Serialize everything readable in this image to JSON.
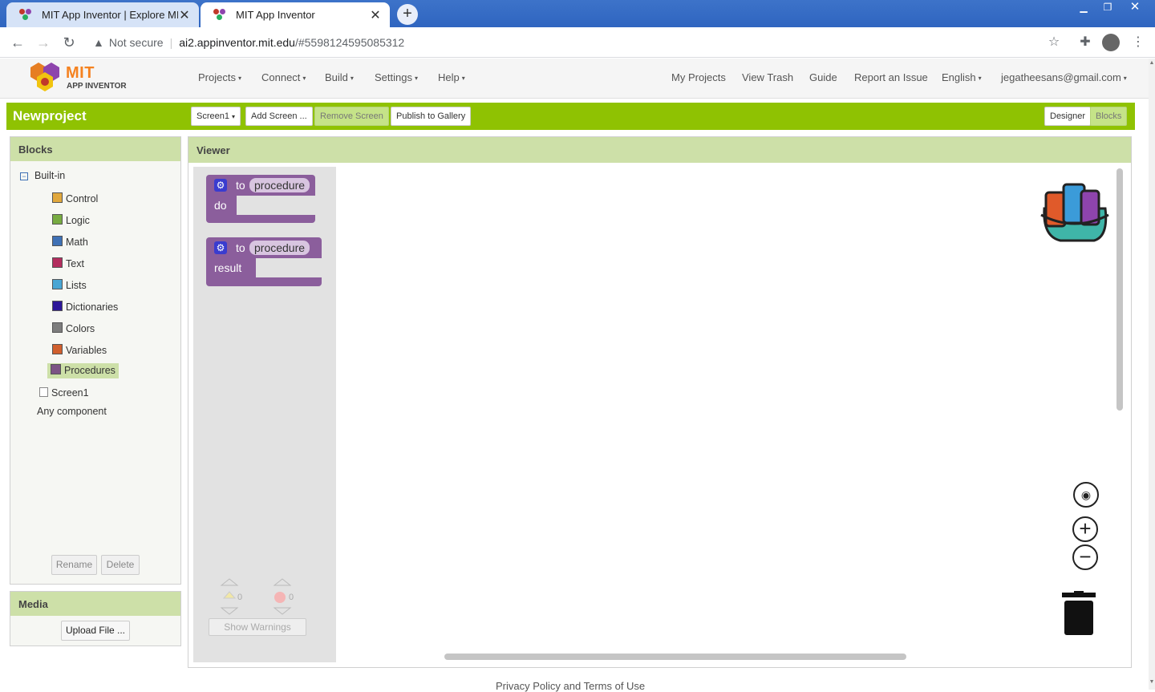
{
  "browser": {
    "tabs": [
      {
        "title": "MIT App Inventor | Explore MIT A"
      },
      {
        "title": "MIT App Inventor"
      }
    ],
    "url_security": "Not secure",
    "url_host": "ai2.appinventor.mit.edu",
    "url_hash": "/#5598124595085312"
  },
  "app": {
    "logo_title": "MIT",
    "logo_subtitle": "APP INVENTOR",
    "menus": [
      "Projects",
      "Connect",
      "Build",
      "Settings",
      "Help"
    ],
    "right_links": [
      "My Projects",
      "View Trash",
      "Guide",
      "Report an Issue",
      "English",
      "jegatheesans@gmail.com"
    ],
    "project_name": "Newproject",
    "toolbar": {
      "screen_select": "Screen1",
      "add_screen": "Add Screen ...",
      "remove_screen": "Remove Screen",
      "publish": "Publish to Gallery",
      "designer": "Designer",
      "blocks": "Blocks"
    }
  },
  "blocks_panel": {
    "title": "Blocks",
    "builtin": "Built-in",
    "categories": [
      {
        "label": "Control",
        "color": "#e1a83d"
      },
      {
        "label": "Logic",
        "color": "#77ab41"
      },
      {
        "label": "Math",
        "color": "#3f71b5"
      },
      {
        "label": "Text",
        "color": "#b32d5e"
      },
      {
        "label": "Lists",
        "color": "#49a6d4"
      },
      {
        "label": "Dictionaries",
        "color": "#2d1799"
      },
      {
        "label": "Colors",
        "color": "#7d7d7d"
      },
      {
        "label": "Variables",
        "color": "#d05f2d"
      },
      {
        "label": "Procedures",
        "color": "#7c5385"
      }
    ],
    "screen": "Screen1",
    "any_component": "Any component",
    "rename": "Rename",
    "delete": "Delete"
  },
  "media_panel": {
    "title": "Media",
    "upload": "Upload File ..."
  },
  "viewer": {
    "title": "Viewer",
    "block1": {
      "to": "to",
      "name": "procedure",
      "do": "do"
    },
    "block2": {
      "to": "to",
      "name": "procedure",
      "result": "result"
    },
    "warnings_count": "0",
    "errors_count": "0",
    "show_warnings": "Show Warnings"
  },
  "footer": "Privacy Policy and Terms of Use"
}
